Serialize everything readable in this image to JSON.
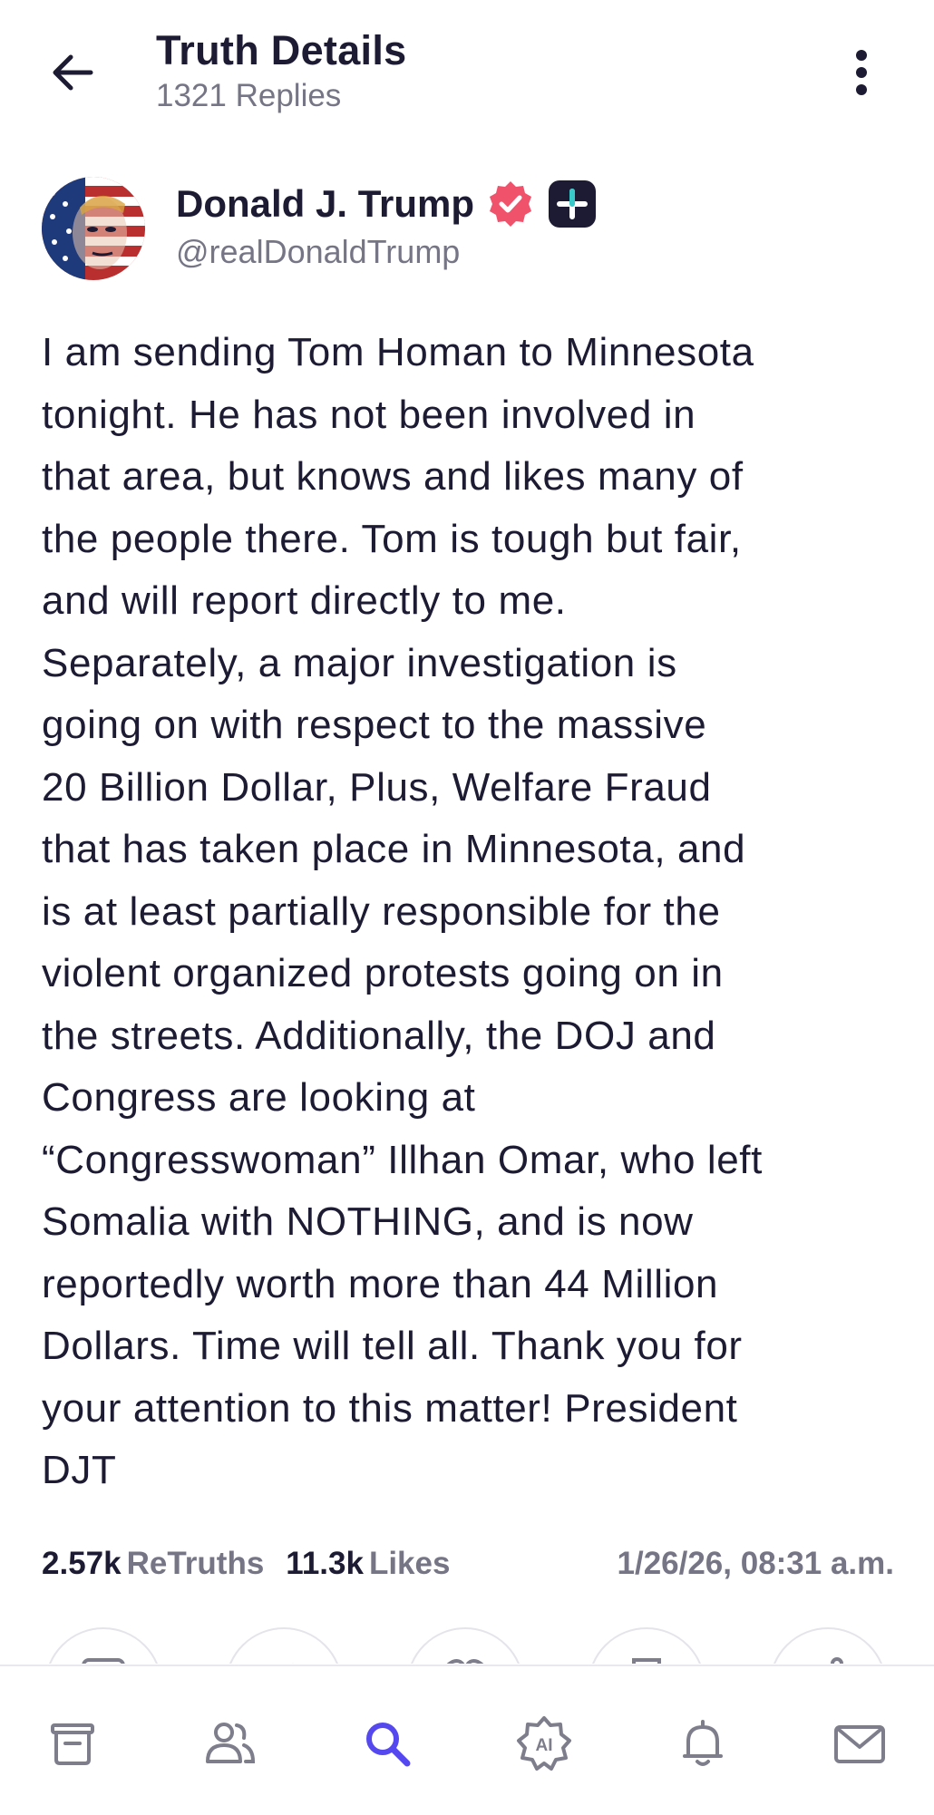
{
  "header": {
    "title": "Truth Details",
    "replies": "1321 Replies",
    "back_icon": "arrow-left-icon",
    "more_icon": "more-vertical-icon"
  },
  "author": {
    "name": "Donald J. Trump",
    "handle": "@realDonaldTrump",
    "verified_icon": "verified-badge-icon",
    "plus_icon": "plus-badge-icon",
    "verified_color": "#f0526b"
  },
  "post": {
    "text": "I am sending Tom Homan to Minnesota\ntonight. He has not been involved in\nthat area, but knows and likes many of\nthe people there. Tom is tough but fair,\nand will report directly to me.\nSeparately, a major investigation is\ngoing on with respect to the massive\n20 Billion Dollar, Plus, Welfare Fraud\nthat has taken place in Minnesota, and\nis at least partially responsible for the\nviolent organized protests going on in\nthe streets. Additionally, the DOJ and\nCongress are looking at\n“Congresswoman” Illhan Omar, who left\nSomalia with NOTHING, and is now\nreportedly worth more than 44 Million\nDollars. Time will tell all. Thank you for\nyour attention to this matter! President\nDJT"
  },
  "stats": {
    "retruths_count": "2.57k",
    "retruths_label": "ReTruths",
    "likes_count": "11.3k",
    "likes_label": "Likes",
    "timestamp": "1/26/26, 08:31 a.m."
  },
  "actions": [
    "reply-icon",
    "retruth-icon",
    "like-icon",
    "bookmark-icon",
    "share-icon"
  ],
  "nav": {
    "items": [
      "home-icon",
      "groups-icon",
      "search-icon",
      "ai-icon",
      "notifications-icon",
      "messages-icon"
    ],
    "active": "search-icon",
    "active_color": "#5448ee",
    "inactive_color": "#7d7d8c"
  }
}
